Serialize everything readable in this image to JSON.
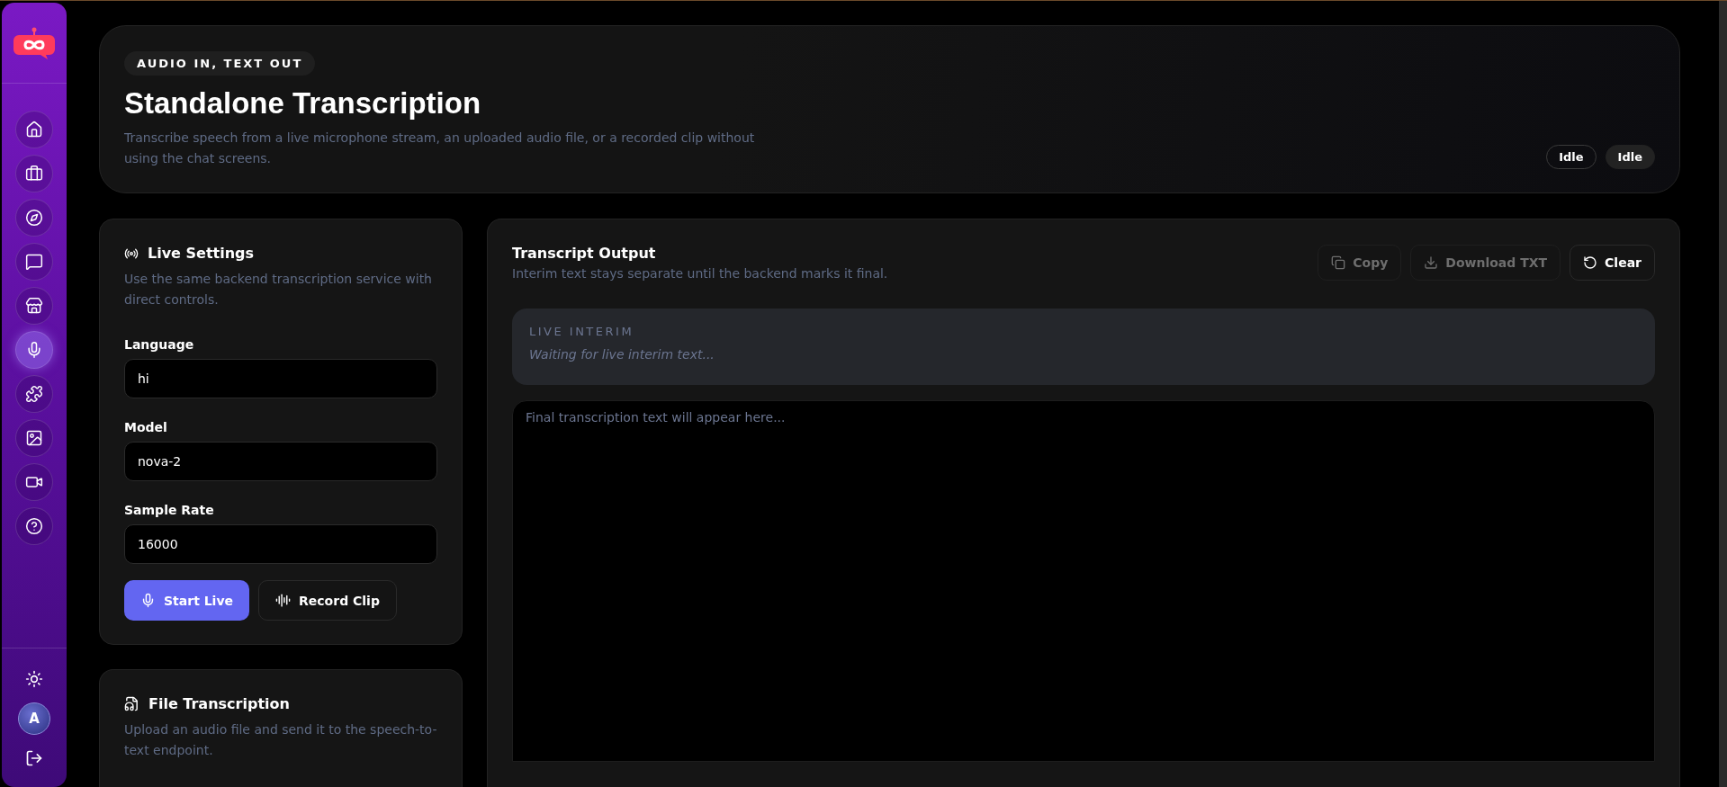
{
  "sidebar": {
    "nav_items": [
      {
        "selected": false
      },
      {
        "selected": false
      },
      {
        "selected": false
      },
      {
        "selected": false
      },
      {
        "selected": false
      },
      {
        "selected": true
      },
      {
        "selected": false
      },
      {
        "selected": false
      },
      {
        "selected": false
      },
      {
        "selected": false
      }
    ],
    "avatar": "A"
  },
  "header": {
    "eyebrow": "AUDIO IN, TEXT OUT",
    "title": "Standalone Transcription",
    "description": "Transcribe speech from a live microphone stream, an uploaded audio file, or a recorded clip without using the chat screens.",
    "statuses": [
      {
        "label": "Idle",
        "kind": "outline"
      },
      {
        "label": "Idle",
        "kind": "filled"
      }
    ]
  },
  "live_settings": {
    "title": "Live Settings",
    "description": "Use the same backend transcription service with direct controls.",
    "fields": [
      {
        "label": "Language",
        "value": "hi"
      },
      {
        "label": "Model",
        "value": "nova-2"
      },
      {
        "label": "Sample Rate",
        "value": "16000"
      }
    ],
    "buttons": [
      {
        "label": "Start Live",
        "kind": "primary"
      },
      {
        "label": "Record Clip",
        "kind": "secondary"
      }
    ]
  },
  "file_transcription": {
    "title": "File Transcription",
    "description": "Upload an audio file and send it to the speech-to-text endpoint."
  },
  "transcript": {
    "title": "Transcript Output",
    "description": "Interim text stays separate until the backend marks it final.",
    "actions": [
      {
        "label": "Copy",
        "disabled": true
      },
      {
        "label": "Download TXT",
        "disabled": true
      },
      {
        "label": "Clear",
        "disabled": false
      }
    ],
    "interim": {
      "label": "LIVE INTERIM",
      "placeholder": "Waiting for live interim text..."
    },
    "final": {
      "placeholder": "Final transcription text will appear here..."
    }
  }
}
